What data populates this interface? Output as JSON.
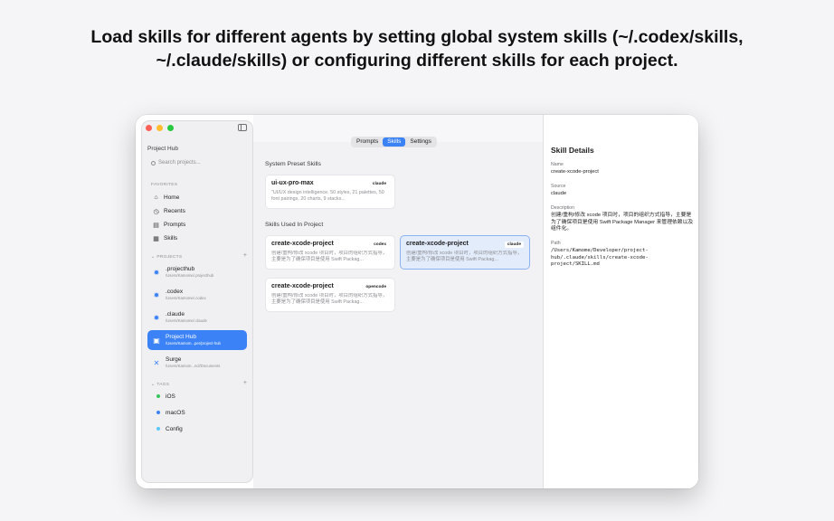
{
  "headline": {
    "line1": "Load skills for different agents by setting global system skills (~/.codex/skills,",
    "line2": "~/.claude/skills) or configuring different skills for each project."
  },
  "sidebar": {
    "app_title": "Project Hub",
    "search_placeholder": "Search projects...",
    "favorites_label": "FAVORITES",
    "favorites": [
      {
        "label": "Home",
        "icon": "house-icon"
      },
      {
        "label": "Recents",
        "icon": "clock-icon"
      },
      {
        "label": "Prompts",
        "icon": "book-icon"
      },
      {
        "label": "Skills",
        "icon": "grid-icon"
      }
    ],
    "projects_label": "PROJECTS",
    "projects": [
      {
        "name": ".projecthub",
        "path": "/Users/Kamome/.projecthub",
        "icon": "gear-icon"
      },
      {
        "name": ".codex",
        "path": "/Users/Kamome/.codex",
        "icon": "gear-icon"
      },
      {
        "name": ".claude",
        "path": "/Users/Kamome/.claude",
        "icon": "gear-icon"
      },
      {
        "name": "Project Hub",
        "path": "/Users/Kamom...per/project-hub",
        "icon": "app-icon"
      },
      {
        "name": "Surge",
        "path": "/Users/Kamom...ncl/Documents",
        "icon": "tools-icon"
      }
    ],
    "tags_label": "TAGS",
    "tags": [
      {
        "label": "iOS",
        "color": "#34c759"
      },
      {
        "label": "macOS",
        "color": "#3b82f6"
      },
      {
        "label": "Config",
        "color": "#5ac8fa"
      }
    ]
  },
  "tabs": [
    "Prompts",
    "Skills",
    "Settings"
  ],
  "main": {
    "system_title": "System Preset Skills",
    "system_skills": [
      {
        "name": "ui-ux-pro-max",
        "badge": "claude",
        "desc": "\"UI/UX design intelligence. 50 styles, 21 palettes, 50 font pairings, 20 charts, 9 stacks..."
      }
    ],
    "project_title": "Skills Used In Project",
    "project_skills": [
      {
        "name": "create-xcode-project",
        "badge": "codex",
        "desc": "创建/重构/修改 xcode 项目时，项目的组织方式指导，主要是为了确保项目是使用 Swift Packag..."
      },
      {
        "name": "create-xcode-project",
        "badge": "claude",
        "desc": "创建/重构/修改 xcode 项目时，项目的组织方式指导，主要是为了确保项目是使用 Swift Packag..."
      },
      {
        "name": "create-xcode-project",
        "badge": "opencode",
        "desc": "创建/重构/修改 xcode 项目时，项目的组织方式指导，主要是为了确保项目是使用 Swift Packag..."
      }
    ]
  },
  "details": {
    "title": "Skill Details",
    "name_label": "Name",
    "name_value": "create-xcode-project",
    "source_label": "Source",
    "source_value": "claude",
    "description_label": "Description",
    "description_value": "创建/重构/修改 xcode 项目时，项目的组织方式指导，主要是为了确保项目是使用 Swift Package Manager 来管理依赖以及组件化。",
    "path_label": "Path",
    "path_value": "/Users/Kamome/Developer/project-hub/.claude/skills/create-xcode-project/SKILL.md"
  }
}
